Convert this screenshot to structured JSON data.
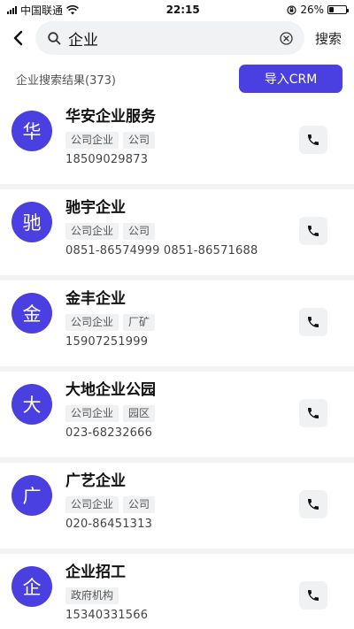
{
  "status": {
    "carrier": "中国联通",
    "time": "22:15",
    "battery": "26%",
    "battery_level": 0.26
  },
  "search": {
    "value": "企业",
    "action_label": "搜索"
  },
  "results": {
    "count_label": "企业搜索结果(373)",
    "import_label": "导入CRM"
  },
  "accent": "#4a3fe0",
  "items": [
    {
      "avatar": "华",
      "name": "华安企业服务",
      "tags": [
        "公司企业",
        "公司"
      ],
      "phone": "18509029873"
    },
    {
      "avatar": "驰",
      "name": "驰宇企业",
      "tags": [
        "公司企业",
        "公司"
      ],
      "phone": "0851-86574999 0851-86571688"
    },
    {
      "avatar": "金",
      "name": "金丰企业",
      "tags": [
        "公司企业",
        "厂矿"
      ],
      "phone": "15907251999"
    },
    {
      "avatar": "大",
      "name": "大地企业公园",
      "tags": [
        "公司企业",
        "园区"
      ],
      "phone": "023-68232666"
    },
    {
      "avatar": "广",
      "name": "广艺企业",
      "tags": [
        "公司企业",
        "公司"
      ],
      "phone": "020-86451313"
    },
    {
      "avatar": "企",
      "name": "企业招工",
      "tags": [
        "政府机构"
      ],
      "phone": "15340331566"
    }
  ]
}
